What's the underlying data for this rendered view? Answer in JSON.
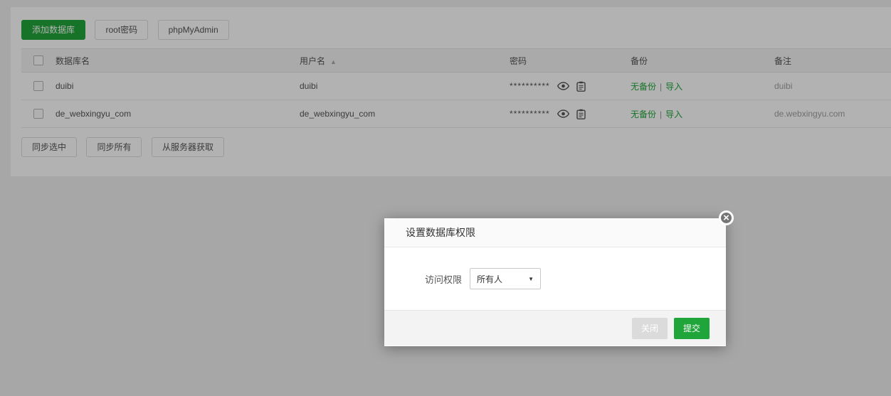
{
  "colors": {
    "accent_green": "#20a53a",
    "page_bg": "#efefef"
  },
  "toolbar": {
    "add_db_label": "添加数据库",
    "root_pwd_label": "root密码",
    "phpmyadmin_label": "phpMyAdmin"
  },
  "table": {
    "headers": [
      "数据库名",
      "用户名",
      "密码",
      "备份",
      "备注"
    ],
    "rows": [
      {
        "name": "duibi",
        "user": "duibi",
        "password_mask": "**********",
        "backup_link": "无备份",
        "separator": "|",
        "import_link": "导入",
        "note": "duibi"
      },
      {
        "name": "de_webxingyu_com",
        "user": "de_webxingyu_com",
        "password_mask": "**********",
        "backup_link": "无备份",
        "separator": "|",
        "import_link": "导入",
        "note": "de.webxingyu.com"
      }
    ]
  },
  "bottom_actions": {
    "sync_selected_label": "同步选中",
    "sync_all_label": "同步所有",
    "fetch_from_server_label": "从服务器获取"
  },
  "modal": {
    "title": "设置数据库权限",
    "access_label": "访问权限",
    "select_value": "所有人",
    "close_label": "关闭",
    "submit_label": "提交"
  },
  "icons": {
    "sort_asc": "▲",
    "caret_down": "▼",
    "close_x": "×"
  }
}
